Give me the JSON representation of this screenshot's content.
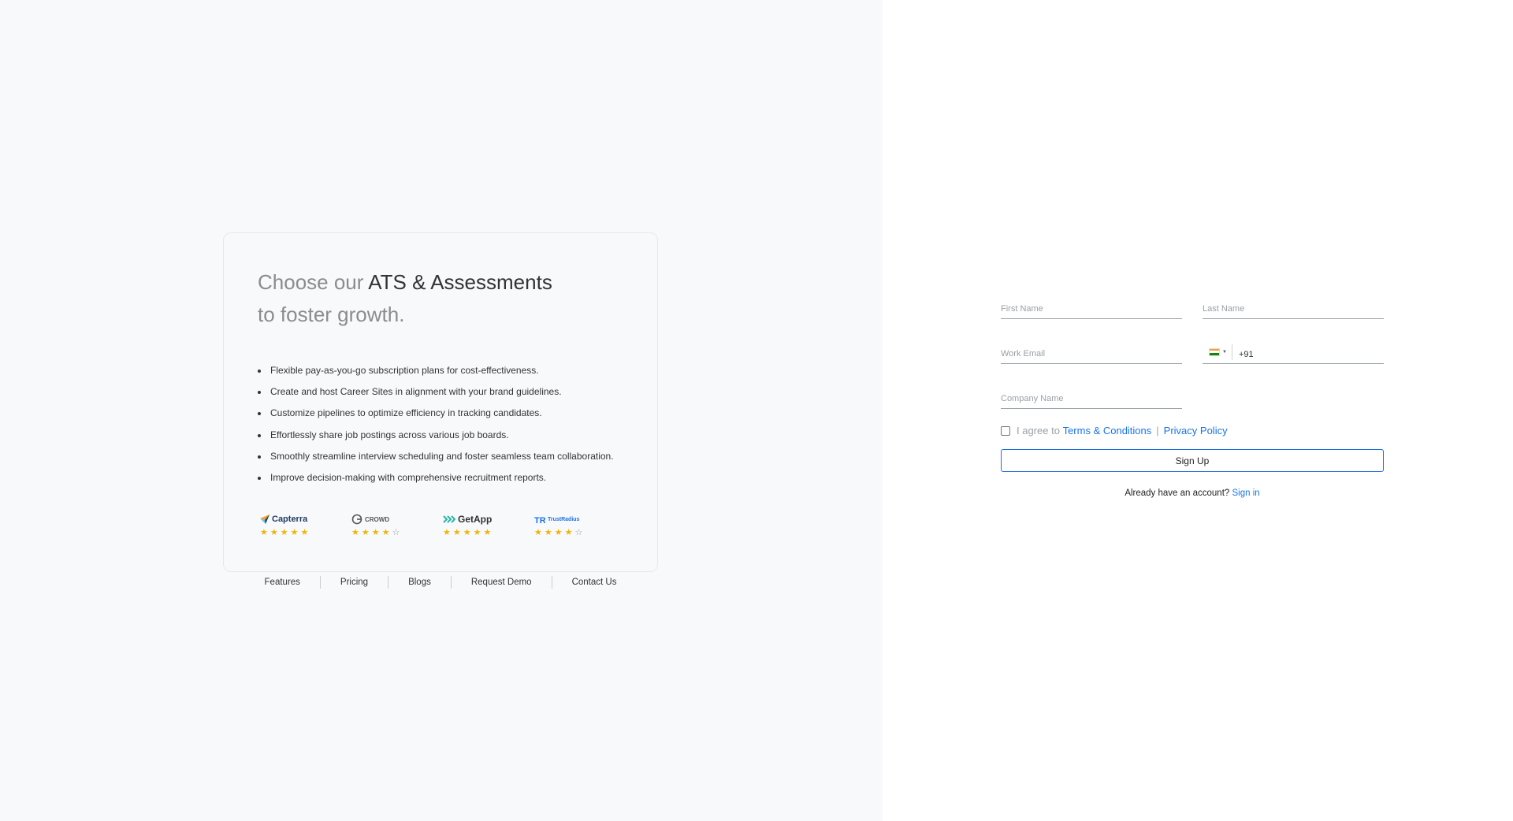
{
  "promo": {
    "headline_prefix": "Choose our",
    "headline_strong": "ATS & Assessments",
    "headline_suffix": "to foster growth.",
    "features": [
      "Flexible pay-as-you-go subscription plans for cost-effectiveness.",
      "Create and host Career Sites in alignment with your brand guidelines.",
      "Customize pipelines to optimize efficiency in tracking candidates.",
      "Effortlessly share job postings across various job boards.",
      "Smoothly streamline interview scheduling and foster seamless team collaboration.",
      "Improve decision-making with comprehensive recruitment reports."
    ],
    "ratings": [
      {
        "brand": "Capterra",
        "icon": "capterra-logo-icon",
        "stars": 5
      },
      {
        "brand": "CROWD",
        "icon": "g2-crowd-logo-icon",
        "stars": 4
      },
      {
        "brand": "GetApp",
        "icon": "getapp-logo-icon",
        "stars": 5
      },
      {
        "brand": "TrustRadius",
        "icon": "trustradius-logo-icon",
        "stars": 4
      }
    ]
  },
  "footer": {
    "links": [
      "Features",
      "Pricing",
      "Blogs",
      "Request Demo",
      "Contact Us"
    ]
  },
  "form": {
    "first_name_placeholder": "First Name",
    "last_name_placeholder": "Last Name",
    "work_email_placeholder": "Work Email",
    "phone_code": "+91",
    "country_flag": "india-flag-icon",
    "company_name_placeholder": "Company Name",
    "terms_prefix": "I agree to",
    "terms_link": "Terms & Conditions",
    "terms_separator": "|",
    "privacy_link": "Privacy Policy",
    "signup_label": "Sign Up",
    "have_account_text": "Already have an account?",
    "signin_link": "Sign in"
  },
  "colors": {
    "link": "#1a73e8",
    "star": "#f5b301",
    "left_bg": "#f8f9fb"
  }
}
